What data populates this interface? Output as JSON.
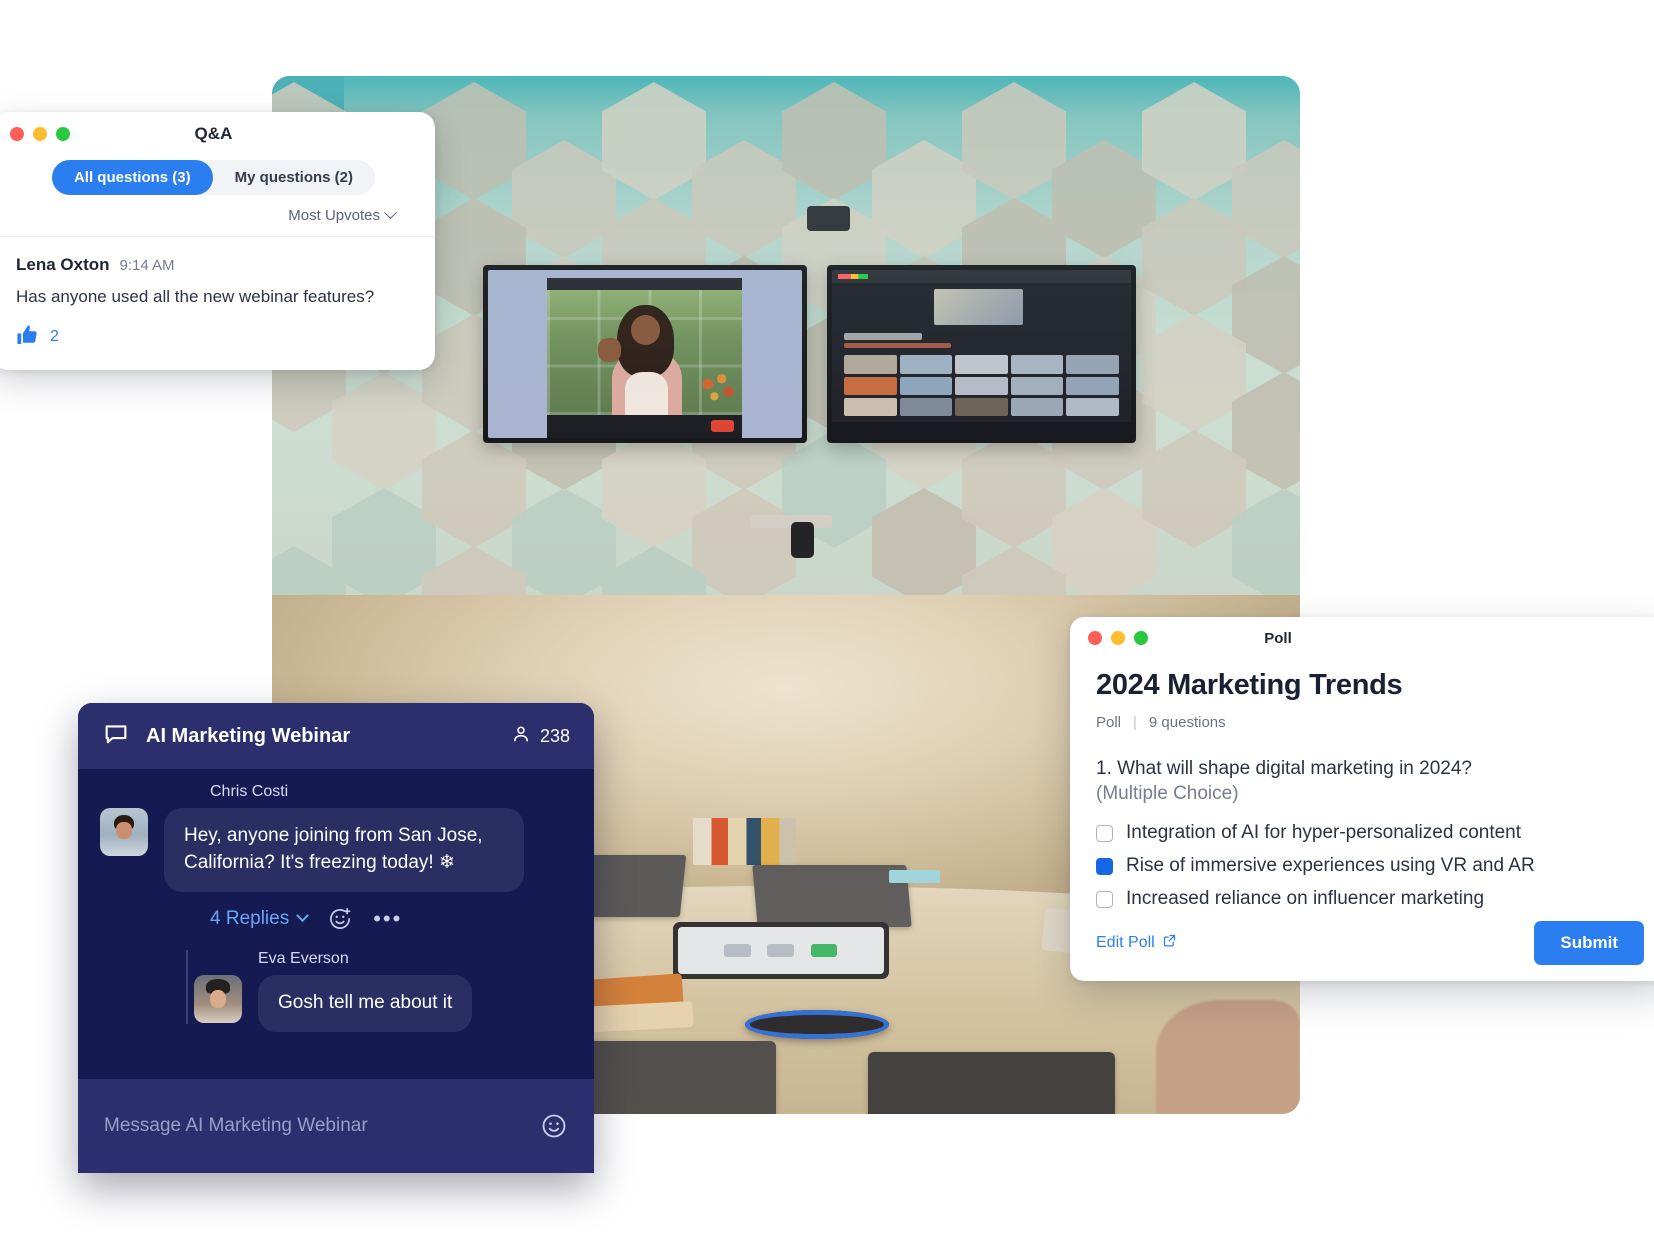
{
  "qa_panel": {
    "window_title": "Q&A",
    "traffic_lights": [
      "close",
      "minimize",
      "maximize"
    ],
    "tabs": [
      {
        "label": "All questions (3)",
        "active": true
      },
      {
        "label": "My questions (2)",
        "active": false
      }
    ],
    "sort": {
      "label": "Most Upvotes",
      "icon": "chevron-down-icon"
    },
    "questions": [
      {
        "author": "Lena Oxton",
        "time": "9:14 AM",
        "text": "Has anyone used all the new webinar features?",
        "upvotes": "2",
        "upvote_icon": "thumbs-up-icon"
      }
    ]
  },
  "chat_panel": {
    "icon": "chat-bubble-icon",
    "name": "AI Marketing Webinar",
    "participants_icon": "person-icon",
    "participants_count": "238",
    "messages": [
      {
        "author": "Chris Costi",
        "avatar": "chris-avatar",
        "text": "Hey, anyone joining from San Jose, California? It's freezing today! ❄",
        "replies_label": "4 Replies",
        "reaction_icon": "add-reaction-icon",
        "more_icon": "more-options-icon",
        "replies": [
          {
            "author": "Eva Everson",
            "avatar": "eva-avatar",
            "text": "Gosh tell me about it"
          }
        ]
      }
    ],
    "composer": {
      "placeholder": "Message AI Marketing Webinar",
      "emoji_icon": "emoji-icon"
    }
  },
  "poll_panel": {
    "window_title": "Poll",
    "traffic_lights": [
      "close",
      "minimize",
      "maximize"
    ],
    "heading": "2024 Marketing Trends",
    "meta_type": "Poll",
    "meta_separator": "|",
    "meta_count": "9 questions",
    "question_number_text": "1. What will shape digital marketing in 2024?",
    "question_type": "(Multiple Choice)",
    "options": [
      {
        "label": "Integration of AI for hyper-personalized content",
        "checked": false
      },
      {
        "label": "Rise of immersive experiences using VR and AR",
        "checked": true
      },
      {
        "label": "Increased reliance on influencer marketing",
        "checked": false
      }
    ],
    "edit_link": {
      "label": "Edit Poll",
      "icon": "external-link-icon"
    },
    "submit_label": "Submit"
  },
  "background": {
    "description": "conference-room-photo",
    "left_monitor": "presenter-video-view",
    "right_monitor": "gallery-grid-view"
  },
  "colors": {
    "accent_blue": "#2a7ef0",
    "checkbox_blue": "#1567e8",
    "chat_bg": "#151a52",
    "chat_header_bg": "#2b2f6e",
    "bubble_bg": "#2a2f63",
    "link_blue": "#6ba6f5"
  }
}
